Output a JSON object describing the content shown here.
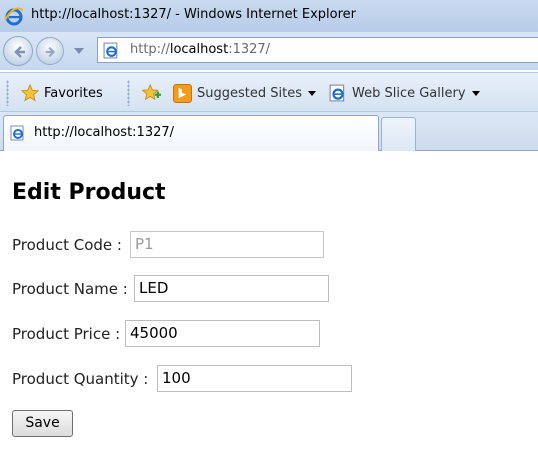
{
  "window": {
    "title": "http://localhost:1327/ - Windows Internet Explorer"
  },
  "address_bar": {
    "url_prefix": "http://",
    "url_host": "localhost",
    "url_suffix": ":1327/"
  },
  "favorites_bar": {
    "favorites_label": "Favorites",
    "suggested_sites_label": "Suggested Sites",
    "web_slice_gallery_label": "Web Slice Gallery"
  },
  "tabs": [
    {
      "label": "http://localhost:1327/",
      "active": true
    }
  ],
  "page": {
    "title": "Edit Product",
    "fields": {
      "code": {
        "label": "Product Code :",
        "value": "P1",
        "disabled": true
      },
      "name": {
        "label": "Product Name :",
        "value": "LED"
      },
      "price": {
        "label": "Product Price :",
        "value": "45000"
      },
      "quantity": {
        "label": "Product Quantity :",
        "value": "100"
      }
    },
    "save_label": "Save"
  },
  "icons": [
    "ie-logo-icon",
    "back-arrow-icon",
    "forward-arrow-icon",
    "recent-pages-dropdown-icon",
    "page-icon",
    "favorites-star-icon",
    "add-to-favorites-icon",
    "bing-icon",
    "ie-page-icon",
    "dropdown-caret-icon"
  ],
  "colors": {
    "titlebar": "#c9daf0",
    "chrome": "#d9e6f6",
    "input_border": "#bdbdbd"
  }
}
